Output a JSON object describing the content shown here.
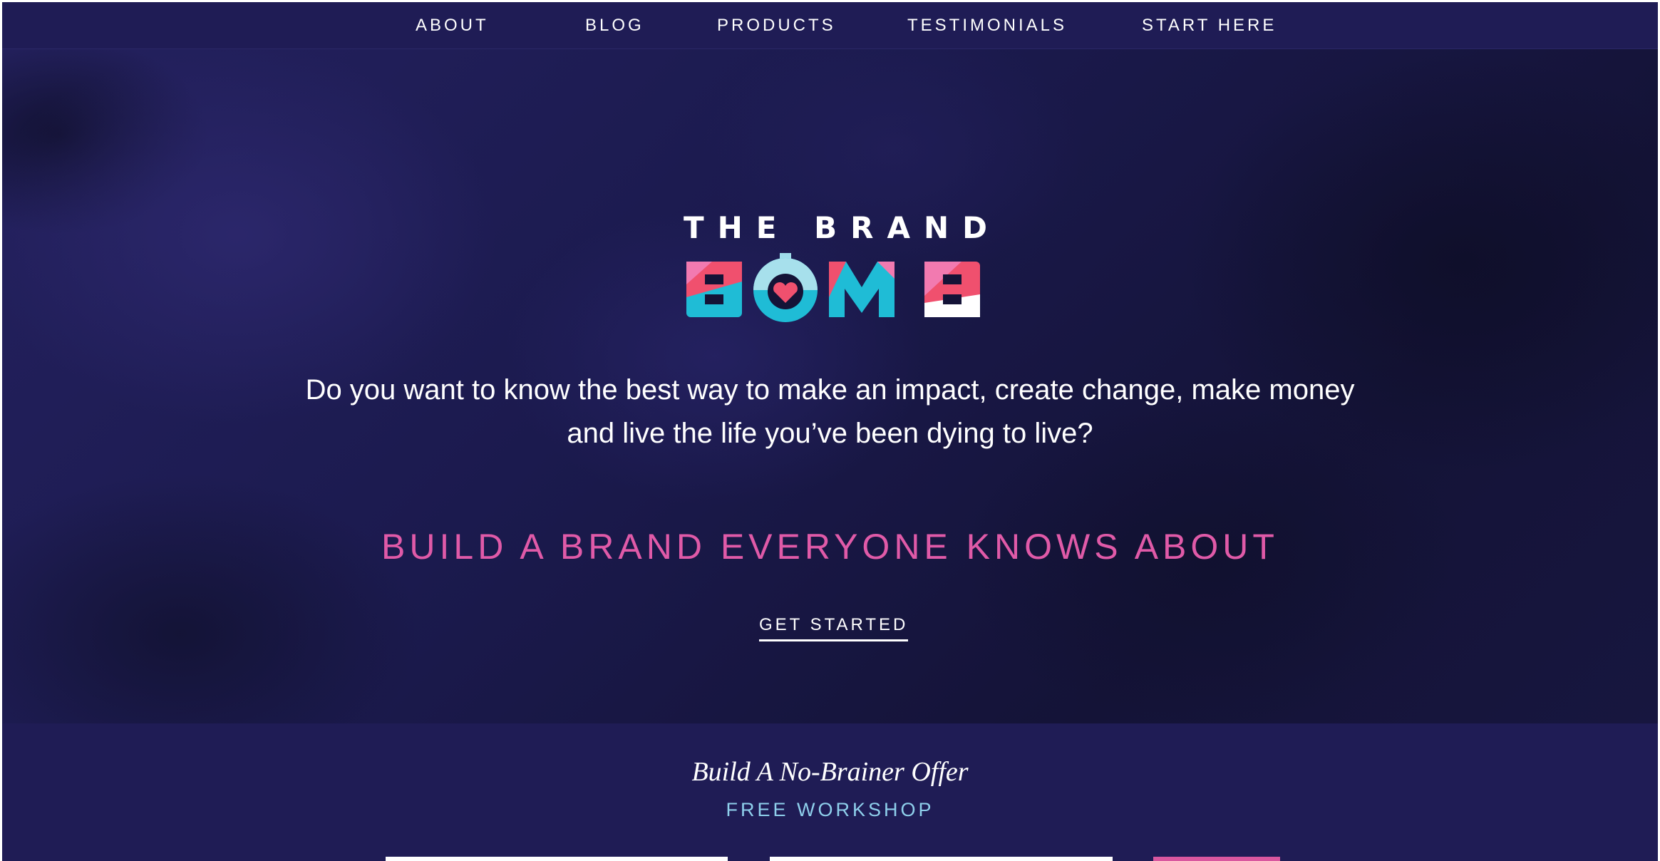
{
  "nav": {
    "items": [
      {
        "label": "ABOUT"
      },
      {
        "label": "BLOG"
      },
      {
        "label": "PRODUCTS"
      },
      {
        "label": "TESTIMONIALS"
      },
      {
        "label": "START HERE"
      }
    ]
  },
  "logo": {
    "top_text": "THE BRAND",
    "word": "BOMB"
  },
  "hero": {
    "lead": "Do you want to know the best way to make an impact, create change, make money and live the life you’ve been dying to live?",
    "tagline": "BUILD A BRAND EVERYONE KNOWS ABOUT",
    "cta": "GET STARTED"
  },
  "offer": {
    "title": "Build A No-Brainer Offer",
    "subtitle": "FREE WORKSHOP"
  },
  "colors": {
    "nav_bg": "#1f1c55",
    "hero_bg": "#1b1a4e",
    "accent_pink": "#e05aa8",
    "accent_cyan": "#1fbcd6",
    "accent_red": "#f0506e",
    "subtitle_blue": "#8fd0ec"
  }
}
